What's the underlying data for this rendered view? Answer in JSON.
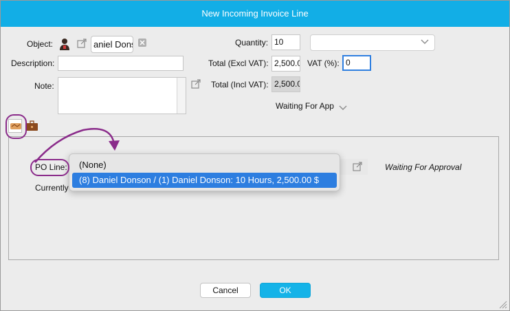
{
  "dialog": {
    "title": "New Incoming Invoice Line"
  },
  "form": {
    "object_label": "Object:",
    "object_value": "aniel Donso",
    "description_label": "Description:",
    "description_value": "",
    "note_label": "Note:",
    "note_value": "",
    "quantity_label": "Quantity:",
    "quantity_value": "10",
    "unit_select_value": "",
    "total_excl_label": "Total (Excl VAT):",
    "total_excl_value": "2,500.0",
    "vat_label": "VAT (%):",
    "vat_value": "0",
    "total_incl_label": "Total (Incl VAT):",
    "total_incl_value": "2,500.0",
    "status_text": "Waiting For App"
  },
  "tabs": [
    {
      "icon": "handshake-icon",
      "selected": true
    },
    {
      "icon": "briefcase-icon",
      "selected": false
    }
  ],
  "panel": {
    "po_line_label": "PO Line:",
    "approval_status": "Waiting For Approval",
    "currently_label": "Currently"
  },
  "po_dropdown": {
    "options": [
      {
        "label": "(None)",
        "selected": false
      },
      {
        "label": "(8) Daniel Donson / (1) Daniel Donson: 10 Hours, 2,500.00 $",
        "selected": true
      }
    ]
  },
  "buttons": {
    "cancel": "Cancel",
    "ok": "OK"
  },
  "colors": {
    "titlebar": "#12aee6",
    "selection": "#2d7ee0",
    "annotation": "#8a2b8a"
  }
}
